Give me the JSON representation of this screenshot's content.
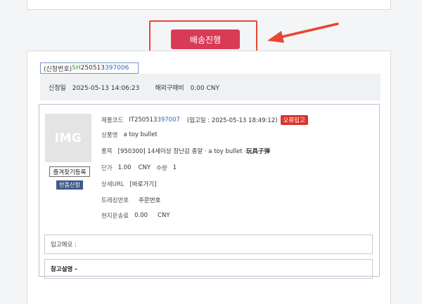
{
  "ship_button": {
    "label": "배송진행"
  },
  "request": {
    "prefix": "(신청번호) ",
    "code_green": "SH",
    "code_mid": "250513",
    "code_blue": "397006"
  },
  "info": {
    "date_label": "신청일",
    "date": "2025-05-13 14:06:23",
    "fee_label": "해외구매비",
    "fee": "0.00 CNY"
  },
  "image": {
    "placeholder": "IMG"
  },
  "buttons": {
    "favorite": "즐겨찾기등록",
    "return": "반품신청"
  },
  "product": {
    "code_label": "제품코드",
    "code_main": "IT250513",
    "code_blue": "397007",
    "stock_in": "(입고일 : 2025-05-13 18:49:12)",
    "error_badge": "오류입고",
    "name_label": "상품명",
    "name": "a toy bullet",
    "category_label": "품목",
    "category": "[950300] 14세이상 장난감 총알 · a toy bullet · ",
    "category_cn": "玩具子弹",
    "price_label": "단가",
    "price": "1.00",
    "currency": "CNY",
    "qty_label": "수량",
    "qty": "1",
    "url_label": "상세URL",
    "url_link": "[바로가기]",
    "tracking_label": "트레킹번호",
    "order_label": "주문번호",
    "shipping_label": "현지운송료",
    "shipping": "0.00",
    "shipping_currency": "CNY"
  },
  "memo": {
    "label": "입고메모 :"
  },
  "note": {
    "label": "참고설명 -"
  }
}
